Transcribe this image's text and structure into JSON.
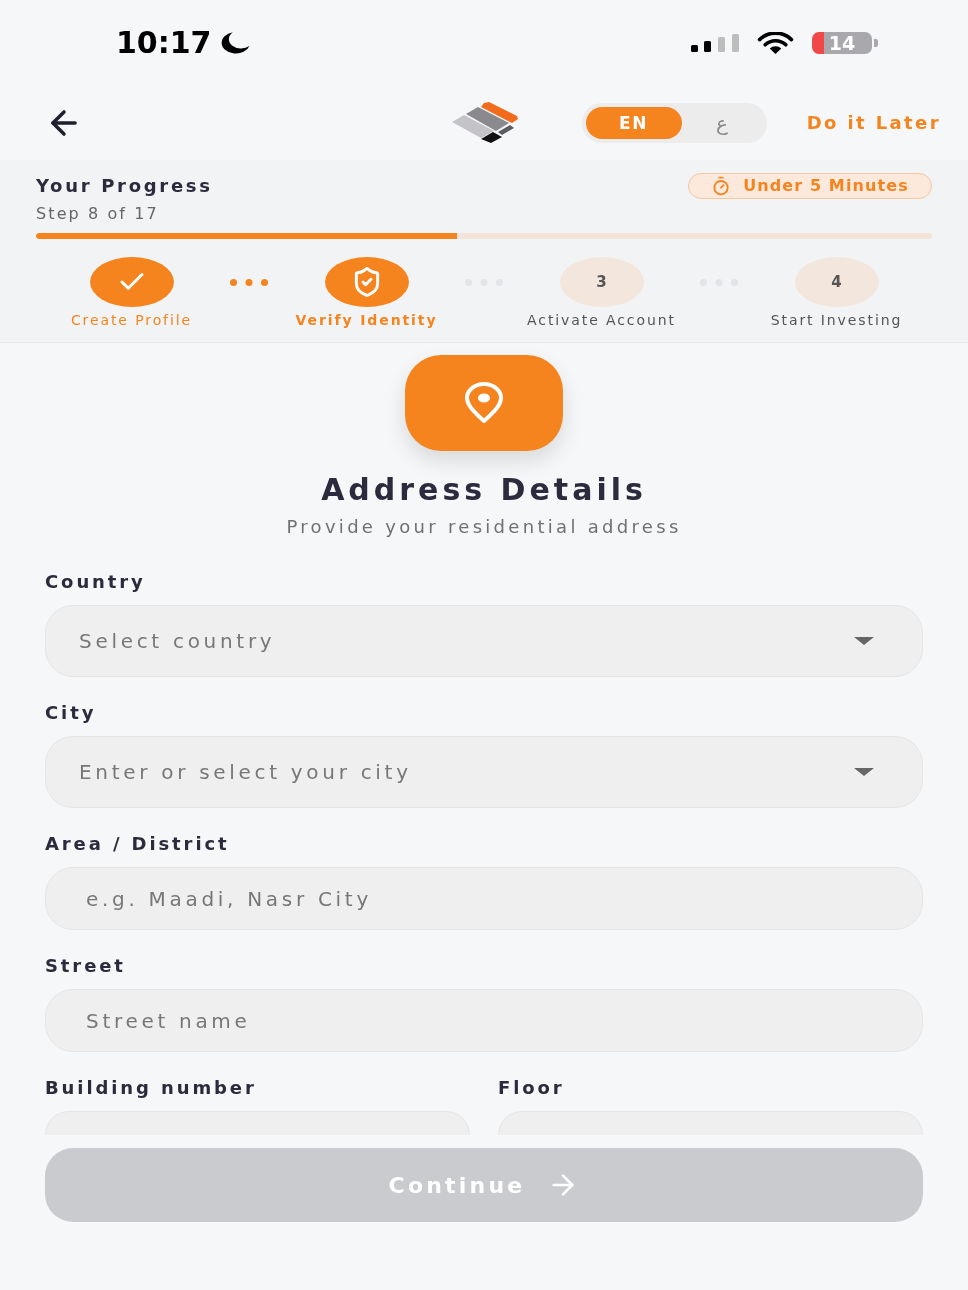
{
  "status_bar": {
    "time": "10:17",
    "battery": "14"
  },
  "header": {
    "languages": [
      {
        "label": "EN",
        "selected": true
      },
      {
        "label": "ع",
        "selected": false
      }
    ],
    "skip_link": "Do it Later"
  },
  "progress": {
    "title": "Your Progress",
    "step_text": "Step 8 of 17",
    "duration": "Under 5 Minutes",
    "level": 0.47,
    "steps": [
      {
        "label": "Create Profile",
        "completed": true,
        "current": false
      },
      {
        "label": "Verify Identity",
        "completed": false,
        "current": true
      },
      {
        "number": "3",
        "label": "Activate Account",
        "completed": false,
        "current": false
      },
      {
        "number": "4",
        "label": "Start Investing",
        "completed": false,
        "current": false
      }
    ]
  },
  "section": {
    "title": "Address Details",
    "subtitle": "Provide your residential address"
  },
  "form": {
    "rows": [
      {
        "fields": [
          {
            "kind": "select",
            "label": "Country",
            "placeholder": "Select country"
          }
        ]
      },
      {
        "fields": [
          {
            "kind": "select",
            "label": "City",
            "placeholder": "Enter or select your city"
          }
        ]
      },
      {
        "fields": [
          {
            "kind": "text",
            "label": "Area / District",
            "placeholder": "e.g. Maadi, Nasr City"
          }
        ]
      },
      {
        "fields": [
          {
            "kind": "text",
            "label": "Street",
            "placeholder": "Street name"
          }
        ]
      },
      {
        "fields": [
          {
            "kind": "text",
            "label": "Building number"
          },
          {
            "kind": "text",
            "label": "Floor"
          }
        ]
      }
    ]
  },
  "continue_button": {
    "label": "Continue",
    "disabled": true
  }
}
